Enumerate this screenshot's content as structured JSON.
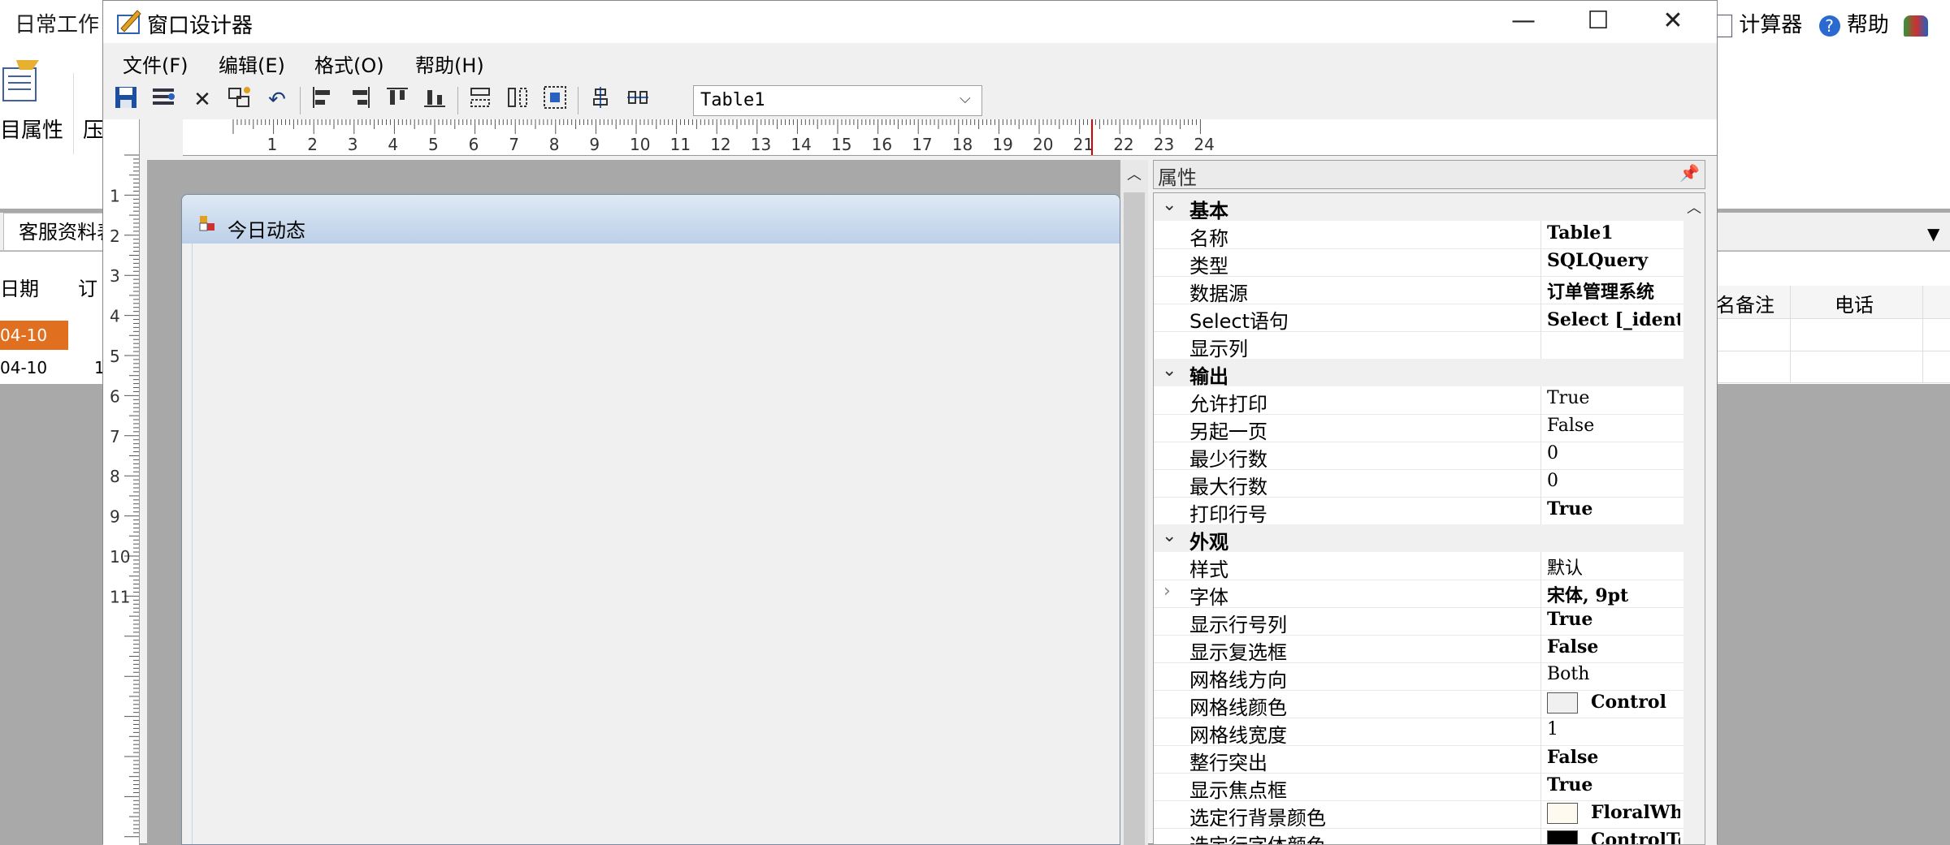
{
  "background_app": {
    "title": "日常工作",
    "ribbon_labels": [
      "目属性",
      "压"
    ],
    "tab_label": "客服资料表",
    "grid_headers": [
      "日期",
      "订"
    ],
    "rows": [
      {
        "date": "04-10",
        "num": ""
      },
      {
        "date": "04-10",
        "num": "1"
      }
    ],
    "right_headers": [
      "名备注",
      "电话"
    ],
    "top_right": {
      "calc": "计算器",
      "help": "帮助"
    }
  },
  "dialog": {
    "title": "窗口设计器",
    "controls": {
      "minimize": "—",
      "maximize": "☐",
      "close": "✕"
    },
    "menus": [
      "文件(F)",
      "编辑(E)",
      "格式(O)",
      "帮助(H)"
    ],
    "table_select": "Table1",
    "ruler_numbers": [
      "1",
      "2",
      "3",
      "4",
      "5",
      "6",
      "7",
      "8",
      "9",
      "10",
      "11",
      "12",
      "13",
      "14",
      "15",
      "16",
      "17",
      "18",
      "19",
      "20",
      "21",
      "22",
      "23",
      "24"
    ],
    "ruler_left_numbers": [
      "1",
      "2",
      "3",
      "4",
      "5",
      "6",
      "7",
      "8",
      "9",
      "10",
      "11"
    ],
    "form": {
      "title": "今日动态"
    },
    "properties": {
      "header": "属性",
      "sections": [
        {
          "name": "基本",
          "props": [
            {
              "name": "名称",
              "value": "Table1",
              "bold": true
            },
            {
              "name": "类型",
              "value": "SQLQuery",
              "bold": true
            },
            {
              "name": "数据源",
              "value": "订单管理系统",
              "bold": true
            },
            {
              "name": "Select语句",
              "value": "Select [_identify],订",
              "bold": true
            },
            {
              "name": "显示列",
              "value": "",
              "bold": false
            }
          ]
        },
        {
          "name": "输出",
          "props": [
            {
              "name": "允许打印",
              "value": "True",
              "bold": false
            },
            {
              "name": "另起一页",
              "value": "False",
              "bold": false
            },
            {
              "name": "最少行数",
              "value": "0",
              "bold": false
            },
            {
              "name": "最大行数",
              "value": "0",
              "bold": false
            },
            {
              "name": "打印行号",
              "value": "True",
              "bold": true
            }
          ]
        },
        {
          "name": "外观",
          "props": [
            {
              "name": "样式",
              "value": "默认",
              "bold": false
            },
            {
              "name": "字体",
              "value": "宋体, 9pt",
              "bold": true,
              "expandable": true
            },
            {
              "name": "显示行号列",
              "value": "True",
              "bold": true
            },
            {
              "name": "显示复选框",
              "value": "False",
              "bold": true
            },
            {
              "name": "网格线方向",
              "value": "Both",
              "bold": false
            },
            {
              "name": "网格线颜色",
              "value": "Control",
              "bold": true,
              "swatch": "#f0f0f0"
            },
            {
              "name": "网格线宽度",
              "value": "1",
              "bold": false
            },
            {
              "name": "整行突出",
              "value": "False",
              "bold": true
            },
            {
              "name": "显示焦点框",
              "value": "True",
              "bold": true
            },
            {
              "name": "选定行背景颜色",
              "value": "FloralWhite",
              "bold": true,
              "swatch": "#fffaf0"
            },
            {
              "name": "选定行字体颜色",
              "value": "ControlText",
              "bold": true,
              "swatch": "#000000"
            }
          ]
        }
      ]
    }
  }
}
